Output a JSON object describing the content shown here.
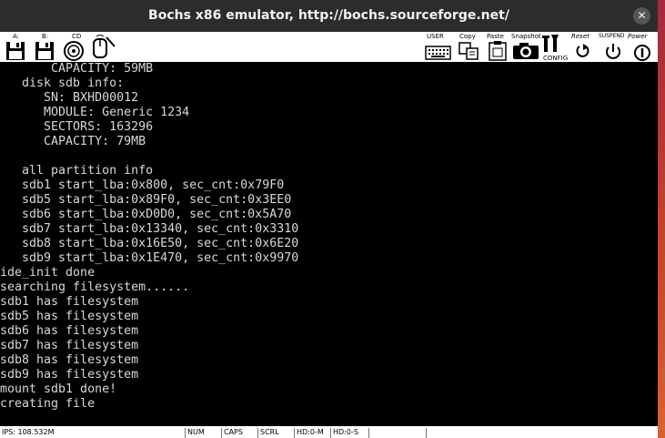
{
  "window": {
    "title": "Bochs x86 emulator, http://bochs.sourceforge.net/",
    "close_glyph": "✕"
  },
  "toolbar": {
    "left": [
      {
        "name": "floppy-a-button",
        "label": "A:",
        "icon": "floppy-icon"
      },
      {
        "name": "floppy-b-button",
        "label": "B:",
        "icon": "floppy-icon"
      },
      {
        "name": "cdrom-button",
        "label": "CD",
        "icon": "cdrom-icon"
      },
      {
        "name": "mouse-button",
        "label": "",
        "icon": "mouse-icon"
      }
    ],
    "right": [
      {
        "name": "user-button",
        "label": "USER",
        "icon": "keyboard-icon"
      },
      {
        "name": "copy-button",
        "label": "Copy",
        "icon": "copy-icon"
      },
      {
        "name": "paste-button",
        "label": "Paste",
        "icon": "paste-icon"
      },
      {
        "name": "snapshot-button",
        "label": "Snapshot",
        "icon": "camera-icon"
      },
      {
        "name": "config-button",
        "label": "CONFIG",
        "icon": "config-icon"
      },
      {
        "name": "reset-button",
        "label": "Reset",
        "icon": "reset-icon"
      },
      {
        "name": "suspend-button",
        "label": "SUSPEND",
        "icon": "suspend-icon"
      },
      {
        "name": "power-button",
        "label": "Power",
        "icon": "power-icon"
      }
    ]
  },
  "console": {
    "lines": [
      "       CAPACITY: 59MB",
      "   disk sdb info:",
      "      SN: BXHD00012",
      "      MODULE: Generic 1234",
      "      SECTORS: 163296",
      "      CAPACITY: 79MB",
      "",
      "   all partition info",
      "   sdb1 start_lba:0x800, sec_cnt:0x79F0",
      "   sdb5 start_lba:0x89F0, sec_cnt:0x3EE0",
      "   sdb6 start_lba:0xD0D0, sec_cnt:0x5A70",
      "   sdb7 start_lba:0x13340, sec_cnt:0x3310",
      "   sdb8 start_lba:0x16E50, sec_cnt:0x6E20",
      "   sdb9 start_lba:0x1E470, sec_cnt:0x9970",
      "ide_init done",
      "searching filesystem......",
      "sdb1 has filesystem",
      "sdb5 has filesystem",
      "sdb6 has filesystem",
      "sdb7 has filesystem",
      "sdb8 has filesystem",
      "sdb9 has filesystem",
      "mount sdb1 done!",
      "creating file"
    ]
  },
  "statusbar": {
    "ips": "IPS: 108.532M",
    "indicators": [
      "",
      "NUM",
      "CAPS",
      "SCRL",
      "HD:0-M",
      "HD:0-S",
      "",
      ""
    ]
  },
  "colors": {
    "titlebar": "#2c2c2c",
    "console_bg": "#000000",
    "console_fg": "#d8d8d8",
    "toolbar": "#ffffff"
  }
}
